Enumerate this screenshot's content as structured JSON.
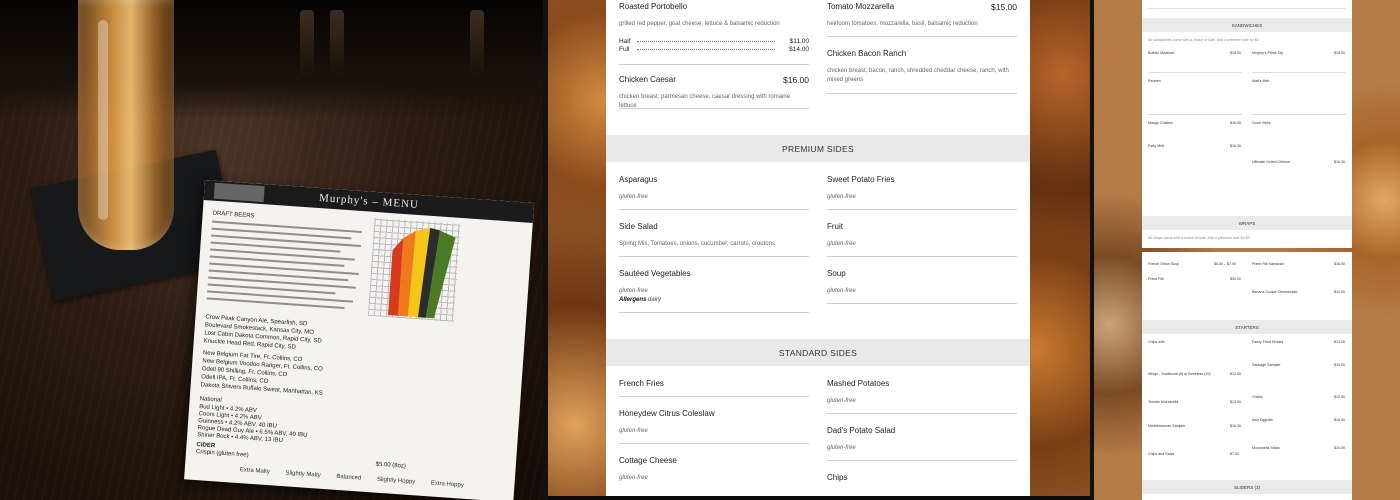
{
  "paper": {
    "title": "Murphy's – MENU",
    "section_draft": "DRAFT BEERS",
    "section_national": "National",
    "section_cider": "CIDER",
    "cider_item": "Crispin (gluten free)",
    "cider_price": "$5.00 (8oz)",
    "lines": [
      "Crow Peak Canyon Ale, Spearfish, SD",
      "Boulevard Smokestack, Kansas City, MO",
      "Lost Cabin Dakota Common, Rapid City, SD",
      "Knuckle Head Red, Rapid City, SD",
      "New Belgium Fat Tire, Ft. Collins, CO",
      "New Belgium Voodoo Ranger, Ft. Collins, CO",
      "Odell 90 Shilling, Ft. Collins, CO",
      "Odell IPA, Ft. Collins, CO",
      "Dakota Shivers Buffalo Sweat, Manhattan, KS",
      "Bud Light • 4.2% ABV",
      "Coors Light • 4.2% ABV",
      "Guinness • 4.2% ABV, 40 IBU",
      "Rogue Dead Guy Ale • 6.5% ABV, 40 IBU",
      "Shiner Bock • 4.4% ABV, 13 IBU"
    ],
    "legend": [
      "Extra Malty",
      "Slightly Malty",
      "Balanced",
      "Slightly Hoppy",
      "Extra Hoppy"
    ],
    "chart_colors": [
      "#d63b1f",
      "#f07a1a",
      "#f5c518",
      "#2c2c2c",
      "#4a7a23"
    ]
  },
  "menu": {
    "items": [
      {
        "name": "Roasted Portobello",
        "price": "",
        "desc": "grilled red pepper, goat cheese, lettuce & balsamic reduction",
        "half_label": "Half",
        "half_price": "$11.00",
        "full_label": "Full",
        "full_price": "$14.00"
      },
      {
        "name": "Tomato Mozzarella",
        "price": "$15.00",
        "desc": "heirloom tomatoes, mozzarella, basil, balsamic reduction"
      },
      {
        "name": "Chicken Bacon Ranch",
        "price": "",
        "desc": "chicken breast, bacon, ranch, shredded cheddar cheese, ranch, with mixed greens"
      },
      {
        "name": "Chicken Caesar",
        "price": "$16.00",
        "desc": "chicken breast, parmesan cheese, caesar dressing with romaine lettuce"
      }
    ],
    "premium_sides": {
      "title": "PREMIUM SIDES",
      "items": [
        {
          "name": "Asparagus",
          "note": "gluten-free"
        },
        {
          "name": "Sweet Potato Fries",
          "note": "gluten-free"
        },
        {
          "name": "Side Salad",
          "note": "Spring Mix, Tomatoes, onions, cucumber, carrots, croutons"
        },
        {
          "name": "Fruit",
          "note": "gluten-free"
        },
        {
          "name": "Sautéed Vegetables",
          "note": "gluten-free",
          "allergen_label": "Allergens",
          "allergen": "dairy"
        },
        {
          "name": "Soup",
          "note": "gluten-free"
        }
      ]
    },
    "standard_sides": {
      "title": "STANDARD SIDES",
      "items": [
        {
          "name": "French Fries",
          "note": ""
        },
        {
          "name": "Mashed Potatoes",
          "note": "gluten-free"
        },
        {
          "name": "Honeydew Citrus Coleslaw",
          "note": "gluten-free"
        },
        {
          "name": "Dad's Potato Salad",
          "note": "gluten-free"
        },
        {
          "name": "Cottage Cheese",
          "note": "gluten-free"
        },
        {
          "name": "Chips",
          "note": ""
        }
      ]
    }
  },
  "shots": {
    "top": {
      "band": "SANDWICHES",
      "intro": "All sandwiches come with a choice of side. Add a premium side for $3",
      "left": [
        {
          "name": "Buffalo Meatloaf",
          "price": "$18.00"
        },
        {
          "name": "Reuben",
          "price": ""
        },
        {
          "name": "Mango Chicken",
          "price": "$16.00"
        },
        {
          "name": "Patty Melt",
          "price": "$16.00"
        }
      ],
      "right": [
        {
          "name": "Murphy's Prime Dip",
          "price": "$18.00"
        },
        {
          "name": "Matt's Melt",
          "price": ""
        },
        {
          "name": "Good Vibes",
          "price": ""
        },
        {
          "name": "Ultimate Grilled Cheese",
          "price": "$16.00"
        }
      ],
      "band2": "WRAPS",
      "wraps_intro": "All wraps come with a choice of side. Add a premium side for $3"
    },
    "bottom": {
      "left": [
        {
          "name": "French Onion Soup",
          "price": "$5.00 – $7.00"
        },
        {
          "name": "Prime Rib",
          "price": "$30.00"
        }
      ],
      "right": [
        {
          "name": "Prime Rib Sandwich",
          "price": "$16.00"
        },
        {
          "name": "Banana Cookie Cheesecake",
          "price": "$10.00"
        }
      ],
      "band": "STARTERS",
      "starters_left": [
        {
          "name": "Chips with",
          "price": ""
        },
        {
          "name": "Wings - Traditional (8) or Boneless (10)",
          "price": "$12.00"
        },
        {
          "name": "Tomato Mozzarella",
          "price": "$12.00"
        },
        {
          "name": "Mediterranean Sampler",
          "price": "$16.00"
        },
        {
          "name": "Chips and Salsa",
          "price": "$7.00"
        }
      ],
      "starters_right": [
        {
          "name": "Fancy Fried Pickles",
          "price": "$13.00"
        },
        {
          "name": "Sausage Sampler",
          "price": "$15.00"
        },
        {
          "name": "Chislic",
          "price": "$12.00"
        },
        {
          "name": "Irish Eggrolls",
          "price": "$16.00"
        },
        {
          "name": "Mozzarella Sticks",
          "price": "$10.00"
        }
      ],
      "band2": "SLIDERS (3)"
    }
  }
}
